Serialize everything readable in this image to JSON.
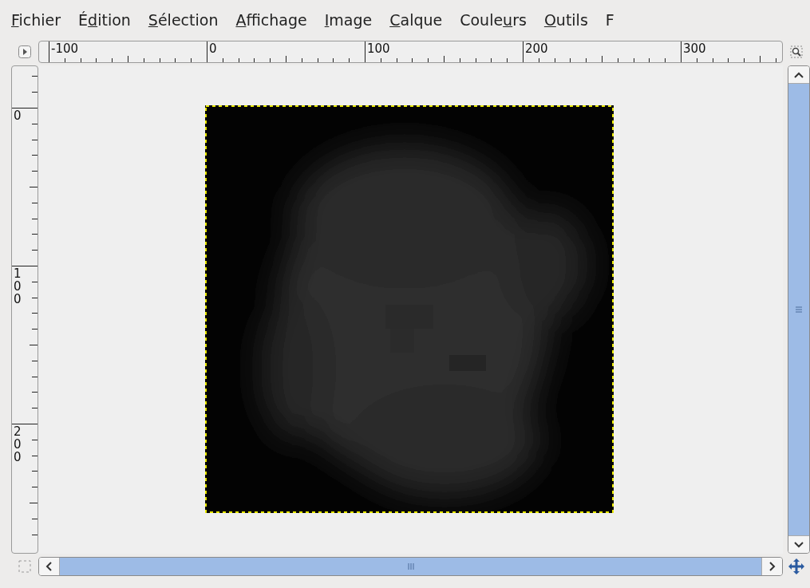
{
  "menu": [
    {
      "key": "F",
      "after": "ichier"
    },
    {
      "before": "É",
      "key": "d",
      "after": "ition"
    },
    {
      "key": "S",
      "after": "élection"
    },
    {
      "key": "A",
      "after": "ffichage"
    },
    {
      "key": "I",
      "after": "mage"
    },
    {
      "key": "C",
      "after": "alque"
    },
    {
      "before": "Coule",
      "key": "u",
      "after": "rs"
    },
    {
      "key": "O",
      "after": "utils"
    },
    {
      "text": "F"
    }
  ],
  "ruler": {
    "horizontal_labels": [
      "-100",
      "0",
      "100",
      "200",
      "300"
    ],
    "vertical_labels": [
      "0",
      "100",
      "200"
    ]
  }
}
